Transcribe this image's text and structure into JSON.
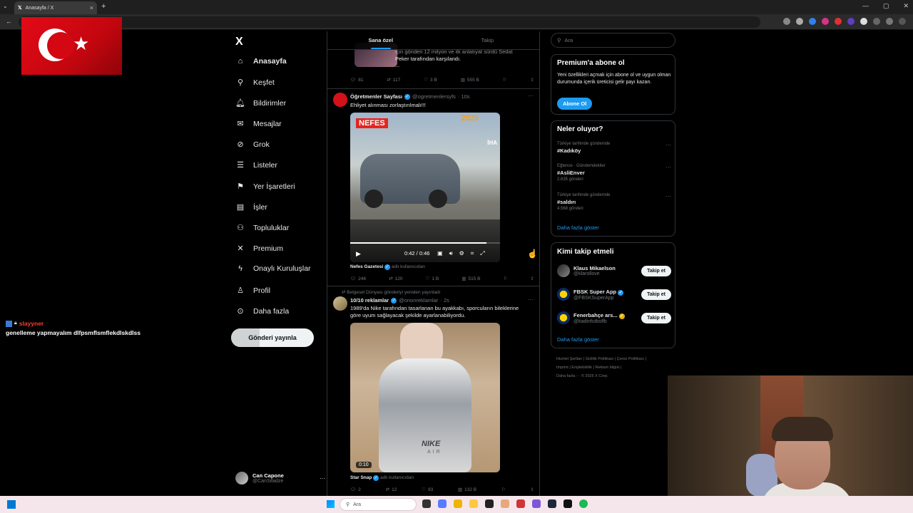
{
  "browser": {
    "tab_title": "Anasayfa / X",
    "new_tab": "+",
    "close": "×"
  },
  "nav": {
    "logo": "X",
    "items": [
      {
        "icon": "home-icon",
        "glyph": "⌂",
        "label": "Anasayfa"
      },
      {
        "icon": "search-icon",
        "glyph": "⚲",
        "label": "Keşfet"
      },
      {
        "icon": "bell-icon",
        "glyph": "🔔︎",
        "label": "Bildirimler"
      },
      {
        "icon": "mail-icon",
        "glyph": "✉",
        "label": "Mesajlar"
      },
      {
        "icon": "grok-icon",
        "glyph": "⊘",
        "label": "Grok"
      },
      {
        "icon": "list-icon",
        "glyph": "☰",
        "label": "Listeler"
      },
      {
        "icon": "bookmark-icon",
        "glyph": "⚑",
        "label": "Yer İşaretleri"
      },
      {
        "icon": "briefcase-icon",
        "glyph": "▤",
        "label": "İşler"
      },
      {
        "icon": "people-icon",
        "glyph": "⚇",
        "label": "Topluluklar"
      },
      {
        "icon": "x-premium-icon",
        "glyph": "✕",
        "label": "Premium"
      },
      {
        "icon": "bolt-icon",
        "glyph": "ϟ",
        "label": "Onaylı Kuruluşlar"
      },
      {
        "icon": "person-icon",
        "glyph": "♙",
        "label": "Profil"
      },
      {
        "icon": "more-circle-icon",
        "glyph": "⊙",
        "label": "Daha fazla"
      }
    ],
    "post_button": "Gönderi yayınla",
    "account": {
      "name": "Can Capone",
      "handle": "@CanSifadze",
      "more": "···"
    }
  },
  "feed": {
    "tabs": [
      "Sana özel",
      "Takip"
    ],
    "top_tweet": {
      "text_line1": "için gönderi 12 milyon ve ilk anlatıyat sürdü Sedat",
      "text_line2": "Peker tarafından karşılandı.",
      "text_line3": "...",
      "actions": {
        "replies": "81",
        "retweets": "117",
        "likes": "3 B",
        "views": "555 B"
      }
    },
    "tweet1": {
      "name": "Öğretmenler Sayfası",
      "handle": "@ogretmenlersyfs",
      "time": "· 10s",
      "text": "Ehliyet alınması zorlaştırılmalı!!!",
      "video": {
        "brand": "NEFES",
        "year": "2025",
        "agency": "İHA",
        "time": "0:42 / 0:46"
      },
      "source_name": "Nefes Gazetesi",
      "source_suffix": "adlı kullanıcıdan",
      "actions": {
        "replies": "246",
        "retweets": "120",
        "likes": "1 B",
        "views": "515 B"
      }
    },
    "tweet2": {
      "repost_note": "Belgesel Dünyası gönderiyi yeniden yayınladı",
      "name": "10/10 reklamlar",
      "handle": "@ononreklamlar",
      "time": "· 2s",
      "text": "1989'da Nike tarafından tasarlanan bu ayakkabı, sporcuların bileklerine göre uyum sağlayacak şekilde ayarlanabiliyordu.",
      "video": {
        "time": "0:10",
        "shoe_brand": "NIKE",
        "shoe_sub": "AIR"
      },
      "source_name": "Star Snap",
      "source_suffix": "adlı kullanıcıdan",
      "actions": {
        "replies": "2",
        "retweets": "12",
        "likes": "93",
        "views": "132 B"
      }
    }
  },
  "right": {
    "search_placeholder": "Ara",
    "premium": {
      "title": "Premium'a abone ol",
      "text": "Yeni özellikleri açmak için abone ol ve uygun olman durumunda içerik üreticisi gelir payı kazan.",
      "button": "Abone Ol"
    },
    "trends": {
      "title": "Neler oluyor?",
      "items": [
        {
          "context": "Türkiye tarihinde gündemde",
          "tag": "#Kadıköy",
          "count": ""
        },
        {
          "context": "Eğlence · Gündemdekiler",
          "tag": "#AsliEnver",
          "count": "2.635 gönderi"
        },
        {
          "context": "Türkiye tarihinde gündemde",
          "tag": "#saldırı",
          "count": "4.568 gönderi"
        }
      ],
      "more": "Daha fazla göster"
    },
    "who_to_follow": {
      "title": "Kimi takip etmeli",
      "items": [
        {
          "name": "Klaus Mikaelson",
          "handle": "@klarollove",
          "button": "Takip et"
        },
        {
          "name": "FBSK Super App",
          "handle": "@FBSKSuperApp",
          "button": "Takip et"
        },
        {
          "name": "Fenerbahçe ars...",
          "handle": "@kadinfutbolfb",
          "button": "Takip et"
        }
      ],
      "more": "Daha fazla göster"
    },
    "footer": {
      "line1": "Hizmet Şartları  |  Gizlilik Politikası  |  Çerez Politikası  |",
      "line2": "Imprint  |  Erişilebilirlik  |  Reklam bilgisi  |",
      "line3": "Daha fazla ···   © 2025 X Corp."
    }
  },
  "chat": {
    "username": "slayyner",
    "message": "genelleme yapmayalım dlfpsmflsmflekdlskdlss"
  },
  "taskbar": {
    "search_placeholder": "Ara"
  },
  "colors": {
    "accent": "#1d9bf0",
    "background": "#000000",
    "chat_user": "#ff3b30",
    "taskbar": "#f5e6ec"
  }
}
